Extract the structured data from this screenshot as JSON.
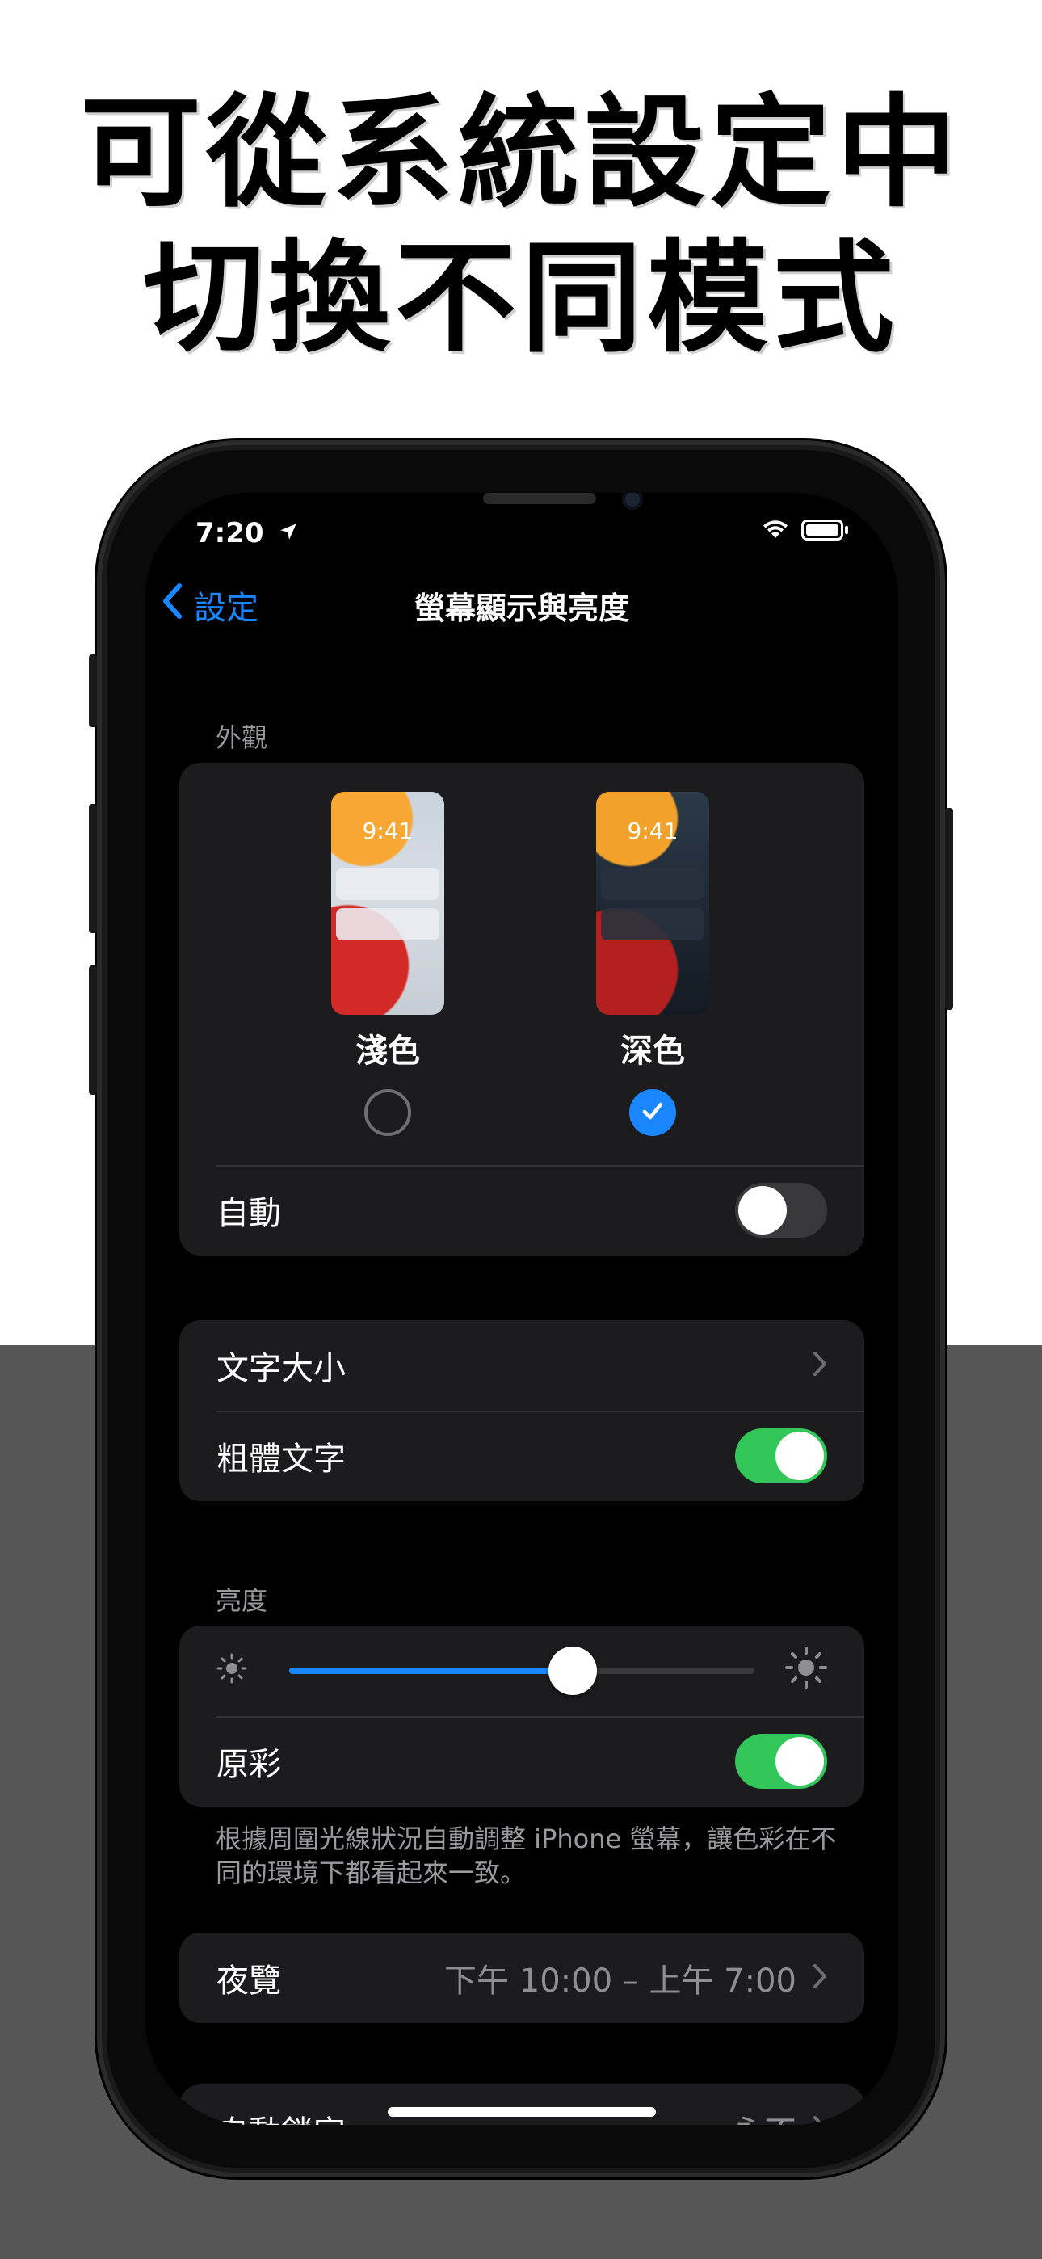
{
  "headline": {
    "line1": "可從系統設定中",
    "line2": "切換不同模式"
  },
  "status": {
    "time": "7:20"
  },
  "nav": {
    "back_label": "設定",
    "title": "螢幕顯示與亮度"
  },
  "appearance": {
    "section_label": "外觀",
    "preview_time": "9:41",
    "light_label": "淺色",
    "dark_label": "深色",
    "selected": "深色",
    "auto_label": "自動",
    "auto_on": false
  },
  "text_group": {
    "text_size_label": "文字大小",
    "bold_text_label": "粗體文字",
    "bold_text_on": true
  },
  "brightness": {
    "section_label": "亮度",
    "level": 0.61,
    "true_tone_label": "原彩",
    "true_tone_on": true,
    "footnote": "根據周圍光線狀況自動調整 iPhone 螢幕，讓色彩在不同的環境下都看起來一致。"
  },
  "night_shift": {
    "label": "夜覽",
    "value": "下午 10:00 – 上午 7:00"
  },
  "auto_lock": {
    "label": "自動鎖定",
    "value": "永不"
  },
  "colors": {
    "accent": "#1a86ff",
    "toggle_on": "#33c759",
    "bottom_background": "#565656"
  }
}
